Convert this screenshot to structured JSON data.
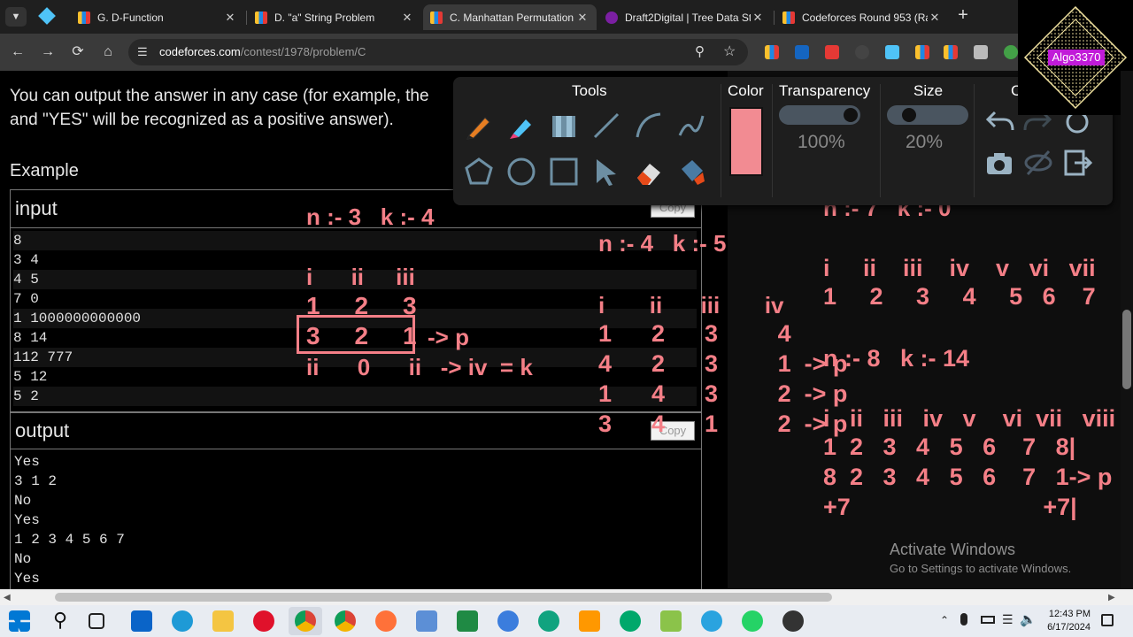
{
  "browser": {
    "tabs": [
      {
        "title": "G. D-Function",
        "color": "#1e88e5",
        "active": false
      },
      {
        "title": "D. \"a\" String Problem",
        "color": "#1e88e5",
        "active": false
      },
      {
        "title": "C. Manhattan Permutation",
        "color": "#1e88e5",
        "active": true
      },
      {
        "title": "Draft2Digital | Tree Data St",
        "color": "#7b1fa2",
        "active": false
      },
      {
        "title": "Codeforces Round 953 (Ra",
        "color": "#1565c0",
        "active": false
      }
    ],
    "new_tab": "+",
    "url_host": "codeforces.com",
    "url_path": "/contest/1978/problem/C"
  },
  "problem": {
    "line1": "You can output the answer in any case (for example, the",
    "line2": "and \"YES\" will be recognized as a positive answer).",
    "example_heading": "Example",
    "input_label": "input",
    "output_label": "output",
    "copy_label": "Copy",
    "input_lines": [
      "8",
      "3 4",
      "4 5",
      "7 0",
      "1 1000000000000",
      "8 14",
      "112 777",
      "5 12",
      "5 2"
    ],
    "output_lines": [
      "Yes",
      "3 1 2",
      "No",
      "Yes",
      "1 2 3 4 5 6 7",
      "No",
      "Yes"
    ]
  },
  "annotations": {
    "a1": "n :- 3   k :- 4",
    "a2": "i      ii     iii",
    "a3": "1     2     3",
    "a4": "3     2     1",
    "a5": "-> p",
    "a6": "ii      0      ii   -> iv  = k",
    "b1": "n :- 4   k :- 5",
    "b2": "i       ii      iii       iv",
    "b3": "1      2      3         4",
    "b4": "4      2      3         1  -> p",
    "b5": "1      4      3         2  -> p",
    "b6": "3      4      1         2  -> p",
    "c0": "n :- 7   k :- 0",
    "c1": "i     ii    iii    iv    v   vi   vii",
    "c2": "1     2     3     4     5   6    7",
    "c3": "n :- 8   k :- 14",
    "c4": "i   ii   iii   iv   v    vi  vii   viii",
    "c5": "1  2   3   4   5   6    7   8|",
    "c6": "8  2   3   4   5   6    7   1-> p",
    "c7": "+7                             +7|"
  },
  "toolbar": {
    "tools_label": "Tools",
    "color_label": "Color",
    "transparency_label": "Transparency",
    "size_label": "Size",
    "clear_label": "C",
    "transparency_value": "100%",
    "size_value": "20%",
    "transparency_fraction": 1.0,
    "size_fraction": 0.2,
    "color_value": "#f28b92"
  },
  "logo": {
    "text": "Algo3370"
  },
  "watermark": {
    "title": "Activate Windows",
    "subtitle": "Go to Settings to activate Windows."
  },
  "taskbar": {
    "time": "12:43 PM",
    "date": "6/17/2024"
  }
}
